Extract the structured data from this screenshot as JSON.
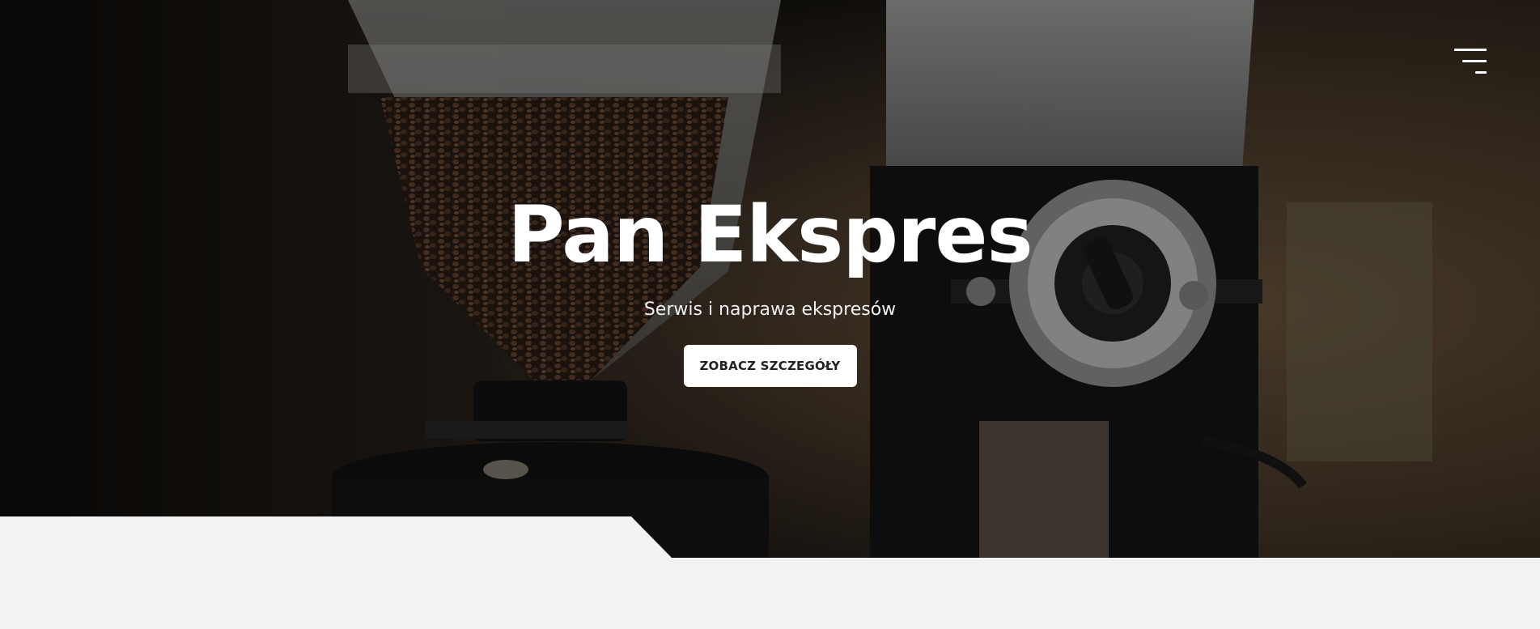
{
  "hero": {
    "title": "Pan Ekspres",
    "subtitle": "Serwis i naprawa ekspresów",
    "cta_label": "ZOBACZ SZCZEGÓŁY",
    "background_image": "coffee-grinder-photo"
  },
  "nav": {
    "menu_icon": "hamburger-menu-icon"
  },
  "colors": {
    "page_background": "#f2f2f2",
    "hero_overlay": "#000000",
    "text_primary": "#ffffff",
    "button_background": "#ffffff",
    "button_text": "#222222"
  }
}
